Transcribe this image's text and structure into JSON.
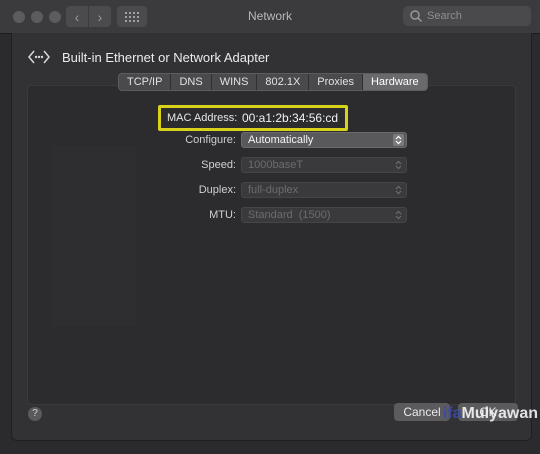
{
  "window": {
    "title": "Network",
    "search_placeholder": "Search"
  },
  "header": {
    "title": "Built-in Ethernet or Network Adapter"
  },
  "tabs": [
    {
      "label": "TCP/IP",
      "active": false
    },
    {
      "label": "DNS",
      "active": false
    },
    {
      "label": "WINS",
      "active": false
    },
    {
      "label": "802.1X",
      "active": false
    },
    {
      "label": "Proxies",
      "active": false
    },
    {
      "label": "Hardware",
      "active": true
    }
  ],
  "hardware": {
    "mac_label": "MAC Address:",
    "mac_value": "00:a1:2b:34:56:cd",
    "configure_label": "Configure:",
    "configure_value": "Automatically",
    "speed_label": "Speed:",
    "speed_value": "1000baseT",
    "duplex_label": "Duplex:",
    "duplex_value": "full-duplex",
    "mtu_label": "MTU:",
    "mtu_value": "Standard  (1500)"
  },
  "buttons": {
    "help": "?",
    "cancel": "Cancel",
    "ok": "OK"
  },
  "watermark": {
    "text_a": "ifa",
    "text_b": "Mulyawan"
  },
  "colors": {
    "highlight": "#d8d21a"
  }
}
